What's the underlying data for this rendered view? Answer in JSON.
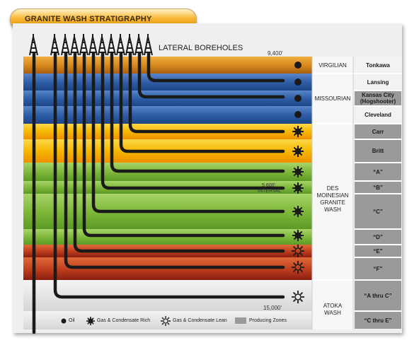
{
  "title": "GRANITE WASH STRATIGRAPHY",
  "header": {
    "boreholes_label": "LATERAL BOREHOLES"
  },
  "depths": {
    "top": "9,400'",
    "interval_1": "5,600'",
    "interval_2": "INTERVAL",
    "bottom": "15,000'"
  },
  "stages": [
    "VIRGILIAN",
    "MISSOURIAN",
    "DES",
    "MOINESIAN",
    "GRANITE",
    "WASH",
    "ATOKA",
    "WASH"
  ],
  "zones": [
    "Tonkawa",
    "Lansing",
    "Kansas City",
    "(Hogshooter)",
    "Cleveland",
    "Carr",
    "Britt",
    "“A”",
    "“B”",
    "“C”",
    "“D”",
    "“E”",
    "“F”",
    "“A thru C”",
    "“C thru E”"
  ],
  "legend": {
    "oil": "Oil",
    "rich": "Gas & Condensate Rich",
    "lean": "Gas & Condensate Lean",
    "producing": "Producing Zones"
  },
  "colors": {
    "orange": "#d98a1e",
    "blue": "#2f5fa8",
    "yellow": "#f5b800",
    "green": "#7fb83a",
    "red": "#b8321c",
    "producing": "#9a9a9a"
  }
}
